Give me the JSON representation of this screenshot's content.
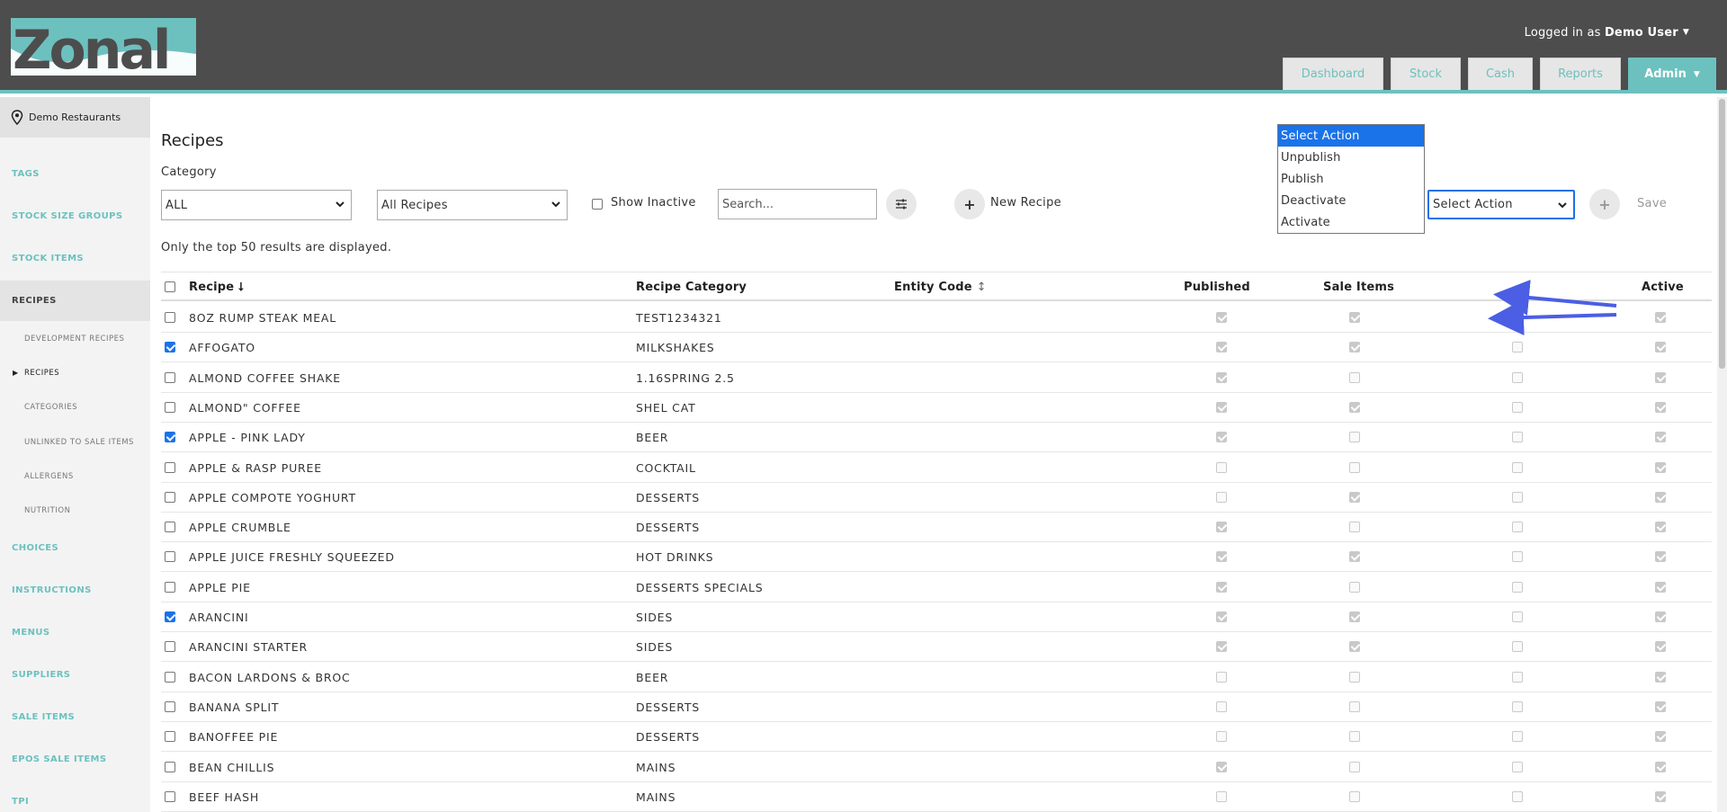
{
  "brand": {
    "logo_text": "Zonal",
    "accent": "#6cc1bf",
    "header_bg": "#4d4d4d"
  },
  "user": {
    "prefix": "Logged in as",
    "name": "Demo User"
  },
  "nav": [
    {
      "label": "Dashboard"
    },
    {
      "label": "Stock"
    },
    {
      "label": "Cash"
    },
    {
      "label": "Reports"
    },
    {
      "label": "Admin",
      "active": true
    }
  ],
  "sidebar": {
    "site": "Demo Restaurants",
    "items": [
      {
        "label": "TAGS"
      },
      {
        "label": "STOCK SIZE GROUPS"
      },
      {
        "label": "STOCK ITEMS"
      },
      {
        "label": "RECIPES",
        "active": true
      },
      {
        "label": "CHOICES"
      },
      {
        "label": "INSTRUCTIONS"
      },
      {
        "label": "MENUS"
      },
      {
        "label": "SUPPLIERS"
      },
      {
        "label": "SALE ITEMS"
      },
      {
        "label": "EPOS SALE ITEMS"
      },
      {
        "label": "TPI"
      }
    ],
    "subitems": [
      {
        "label": "DEVELOPMENT RECIPES"
      },
      {
        "label": "RECIPES",
        "active": true
      },
      {
        "label": "CATEGORIES"
      },
      {
        "label": "UNLINKED TO SALE ITEMS"
      },
      {
        "label": "ALLERGENS"
      },
      {
        "label": "NUTRITION"
      }
    ]
  },
  "main": {
    "title": "Recipes",
    "category_label": "Category",
    "category_value": "ALL",
    "recipes_filter_value": "All Recipes",
    "show_inactive_label": "Show Inactive",
    "search_placeholder": "Search...",
    "new_recipe_label": "New Recipe",
    "action_value": "Select Action",
    "save_label": "Save",
    "info_text": "Only the top 50 results are displayed."
  },
  "action_options": [
    {
      "label": "Select Action",
      "selected": true
    },
    {
      "label": "Unpublish"
    },
    {
      "label": "Publish"
    },
    {
      "label": "Deactivate"
    },
    {
      "label": "Activate"
    }
  ],
  "table": {
    "headers": {
      "recipe": "Recipe",
      "recipe_sort": "⭣",
      "category": "Recipe Category",
      "entity_code": "Entity Code",
      "entity_sort": "↕",
      "published": "Published",
      "sale_items": "Sale Items",
      "active": "Active"
    },
    "rows": [
      {
        "name": "8OZ RUMP STEAK MEAL",
        "category": "TEST1234321",
        "checked": false,
        "published": true,
        "sale_items": true,
        "col5": false,
        "active": true
      },
      {
        "name": "AFFOGATO",
        "category": "MILKSHAKES",
        "checked": true,
        "published": true,
        "sale_items": true,
        "col5": false,
        "active": true
      },
      {
        "name": "ALMOND COFFEE SHAKE",
        "category": "1.16SPRING 2.5",
        "checked": false,
        "published": true,
        "sale_items": false,
        "col5": false,
        "active": true
      },
      {
        "name": "ALMOND\" COFFEE",
        "category": "SHEL CAT",
        "checked": false,
        "published": true,
        "sale_items": true,
        "col5": false,
        "active": true
      },
      {
        "name": "APPLE - PINK LADY",
        "category": "BEER",
        "checked": true,
        "published": true,
        "sale_items": false,
        "col5": false,
        "active": true
      },
      {
        "name": "APPLE & RASP PUREE",
        "category": "COCKTAIL",
        "checked": false,
        "published": false,
        "sale_items": false,
        "col5": false,
        "active": true
      },
      {
        "name": "APPLE COMPOTE YOGHURT",
        "category": "DESSERTS",
        "checked": false,
        "published": false,
        "sale_items": true,
        "col5": false,
        "active": true
      },
      {
        "name": "APPLE CRUMBLE",
        "category": "DESSERTS",
        "checked": false,
        "published": true,
        "sale_items": false,
        "col5": false,
        "active": true
      },
      {
        "name": "APPLE JUICE FRESHLY SQUEEZED",
        "category": "HOT DRINKS",
        "checked": false,
        "published": true,
        "sale_items": true,
        "col5": false,
        "active": true
      },
      {
        "name": "APPLE PIE",
        "category": "DESSERTS SPECIALS",
        "checked": false,
        "published": true,
        "sale_items": false,
        "col5": false,
        "active": true
      },
      {
        "name": "ARANCINI",
        "category": "SIDES",
        "checked": true,
        "published": true,
        "sale_items": true,
        "col5": false,
        "active": true
      },
      {
        "name": "ARANCINI STARTER",
        "category": "SIDES",
        "checked": false,
        "published": true,
        "sale_items": true,
        "col5": false,
        "active": true
      },
      {
        "name": "BACON LARDONS & BROC",
        "category": "BEER",
        "checked": false,
        "published": false,
        "sale_items": false,
        "col5": false,
        "active": true
      },
      {
        "name": "BANANA SPLIT",
        "category": "DESSERTS",
        "checked": false,
        "published": false,
        "sale_items": false,
        "col5": false,
        "active": true
      },
      {
        "name": "BANOFFEE PIE",
        "category": "DESSERTS",
        "checked": false,
        "published": false,
        "sale_items": false,
        "col5": false,
        "active": true
      },
      {
        "name": "BEAN CHILLIS",
        "category": "MAINS",
        "checked": false,
        "published": true,
        "sale_items": false,
        "col5": false,
        "active": true
      },
      {
        "name": "BEEF HASH",
        "category": "MAINS",
        "checked": false,
        "published": false,
        "sale_items": false,
        "col5": false,
        "active": true
      }
    ]
  }
}
